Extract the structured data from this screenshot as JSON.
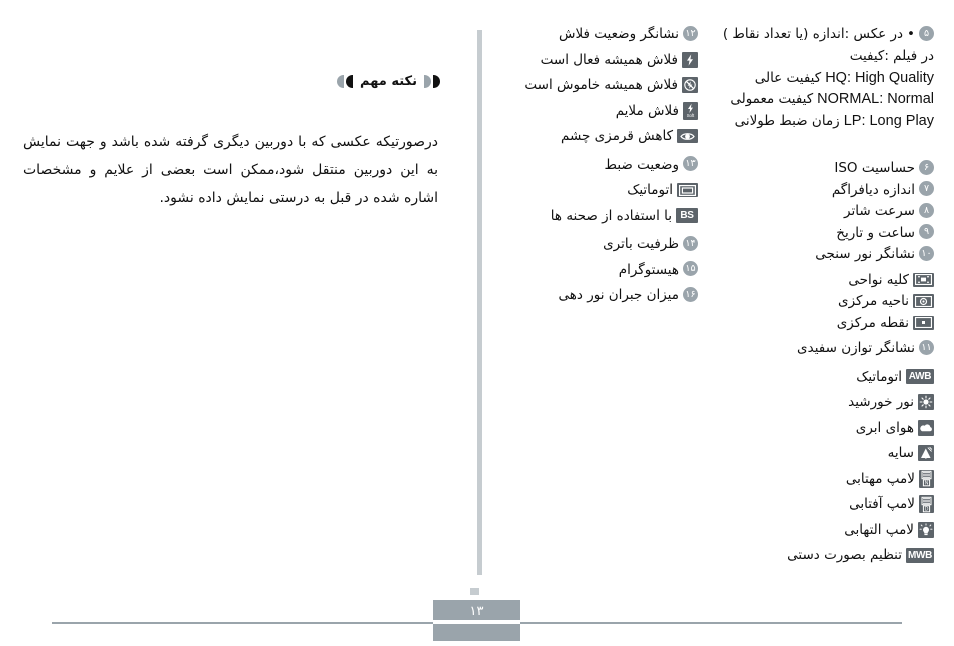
{
  "page": {
    "number": "۱۳",
    "language": "fa"
  },
  "colors": {
    "divider": "#c6ccd0",
    "badge": "#9aa4ab",
    "icon_chip": "#5d646a",
    "footer_rule": "#9aa4ab",
    "text": "#111111"
  },
  "left_column": {
    "note_header": "نکته مهم",
    "note_body": "درصورتیکه عکسی که با دوربین دیگری گرفته شده باشد و  جهت نمایش به این دوربین منتقل شود،ممکن است بعضی از علایم و مشخصات اشاره شده در قبل به درستی نمایش داده نشود."
  },
  "right_column_a": {
    "items": [
      {
        "number": "۵",
        "bullet": "•",
        "label": "در عکس :اندازه (یا تعداد نقاط )"
      }
    ],
    "sub_lines": [
      {
        "label": "در فیلم :کیفیت"
      },
      {
        "label": "کیفیت عالی",
        "latin": "HQ: High Quality"
      },
      {
        "label": "کیفیت معمولی",
        "latin": "NORMAL: Normal"
      },
      {
        "label": "زمان ضبط طولانی",
        "latin": "LP: Long Play"
      }
    ],
    "items_2": [
      {
        "number": "۶",
        "label": "حساسیت ISO"
      },
      {
        "number": "۷",
        "label": "اندازه دیافراگم"
      },
      {
        "number": "۸",
        "label": "سرعت شاتر"
      },
      {
        "number": "۹",
        "label": "ساعت و تاریخ"
      },
      {
        "number": "۱۰",
        "label": "نشانگر نور سنجی"
      }
    ],
    "metering_icons": [
      {
        "icon": "multi-area-metering-icon",
        "label": "کلیه نواحی"
      },
      {
        "icon": "center-area-metering-icon",
        "label": "ناحیه مرکزی"
      },
      {
        "icon": "spot-metering-icon",
        "label": "نقطه مرکزی"
      }
    ],
    "item_11": {
      "number": "۱۱",
      "label": "نشانگر توازن سفیدی"
    },
    "wb_icons": [
      {
        "icon": "awb-icon",
        "chip_text": "AWB",
        "label": "اتوماتیک"
      },
      {
        "icon": "sunlight-icon",
        "label": "نور خورشید"
      },
      {
        "icon": "cloudy-icon",
        "label": "هوای ابری"
      },
      {
        "icon": "shade-icon",
        "label": "سایه"
      },
      {
        "icon": "fluorescent-lamp-1-icon",
        "label": "لامپ مهتابی"
      },
      {
        "icon": "fluorescent-lamp-2-icon",
        "label": "لامپ آفتابی"
      },
      {
        "icon": "tungsten-lamp-icon",
        "label": "لامپ التهابی"
      },
      {
        "icon": "mwb-icon",
        "chip_text": "MWB",
        "label": "تنظیم بصورت دستی"
      }
    ]
  },
  "right_column_b": {
    "item_12": {
      "number": "۱۲",
      "label": "نشانگر وضعیت فلاش"
    },
    "flash_icons": [
      {
        "icon": "flash-always-on-icon",
        "label": "فلاش همیشه فعال است"
      },
      {
        "icon": "flash-always-off-icon",
        "label": "فلاش همیشه خاموش است"
      },
      {
        "icon": "flash-soft-icon",
        "label": "فلاش ملایم"
      },
      {
        "icon": "red-eye-reduction-icon",
        "label": "کاهش قرمزی چشم"
      }
    ],
    "item_13": {
      "number": "۱۳",
      "label": "وضعیت ضبط"
    },
    "record_icons": [
      {
        "icon": "auto-record-icon",
        "label": "اتوماتیک"
      },
      {
        "icon": "best-shot-icon",
        "chip_text": "BS",
        "label": "با استفاده از صحنه ها"
      }
    ],
    "items_tail": [
      {
        "number": "۱۴",
        "label": "ظرفیت باتری"
      },
      {
        "number": "۱۵",
        "label": "هیستوگرام"
      },
      {
        "number": "۱۶",
        "label": "میزان جبران نور دهی"
      }
    ]
  }
}
